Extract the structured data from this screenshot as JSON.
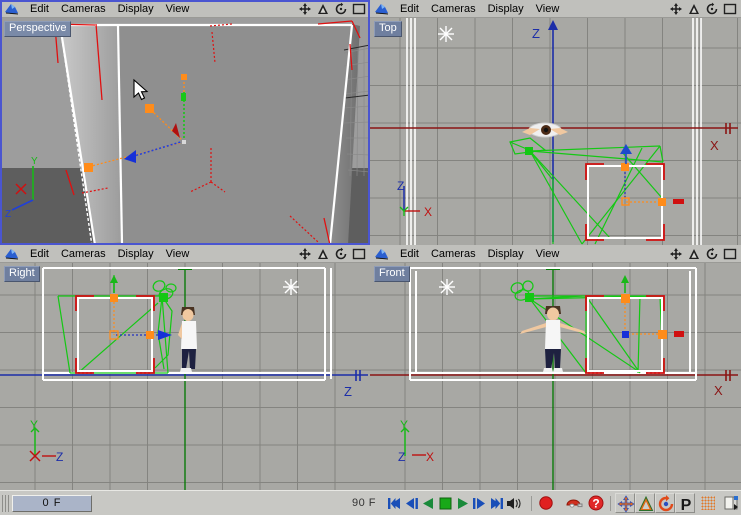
{
  "app": {
    "name": "Cinema 4D",
    "logo_icon": "c4d-logo-icon"
  },
  "viewport_menu": {
    "items": [
      "Edit",
      "Cameras",
      "Display",
      "View"
    ],
    "icons": [
      {
        "name": "move-view-icon",
        "glyph": "✥"
      },
      {
        "name": "scale-view-icon",
        "glyph": "▲"
      },
      {
        "name": "rotate-view-icon",
        "glyph": "↻"
      },
      {
        "name": "maximize-view-icon",
        "glyph": "▭"
      }
    ]
  },
  "viewports": [
    {
      "id": "perspective",
      "label": "Perspective",
      "active": true,
      "axis_gizmo": {
        "x": "X",
        "y": "Y",
        "z": "Z"
      },
      "shaded": true
    },
    {
      "id": "top",
      "label": "Top",
      "active": false,
      "axis_gizmo": {
        "x": "X",
        "z": "Z"
      },
      "world_axis_labels": {
        "vertical": "Z",
        "horizontal": "X"
      },
      "shaded": false
    },
    {
      "id": "right",
      "label": "Right",
      "active": false,
      "axis_gizmo": {
        "x": "X",
        "y": "Y",
        "z": "Z"
      },
      "world_axis_labels": {
        "vertical": "Y",
        "horizontal": "Z"
      },
      "shaded": false
    },
    {
      "id": "front",
      "label": "Front",
      "active": false,
      "axis_gizmo": {
        "x": "X",
        "y": "Y",
        "z": "Z"
      },
      "world_axis_labels": {
        "vertical": "Y",
        "horizontal": "X"
      },
      "shaded": false
    }
  ],
  "statusbar": {
    "current_frame": "0 F",
    "end_frame": "90 F",
    "transport": [
      {
        "name": "go-to-start-button",
        "title": "Go To Start"
      },
      {
        "name": "step-back-button",
        "title": "Previous Frame"
      },
      {
        "name": "play-reverse-button",
        "title": "Play Reverse"
      },
      {
        "name": "stop-button",
        "title": "Stop"
      },
      {
        "name": "play-forward-button",
        "title": "Play Forward"
      },
      {
        "name": "step-forward-button",
        "title": "Next Frame"
      },
      {
        "name": "go-to-end-button",
        "title": "Go To End"
      },
      {
        "name": "sound-toggle-button",
        "title": "Sound"
      }
    ],
    "record_tools": [
      {
        "name": "record-keyframe-button",
        "title": "Record Active Objects"
      },
      {
        "name": "autokeying-button",
        "title": "Autokeying"
      },
      {
        "name": "keyframe-selection-button",
        "title": "Keyframe Selection"
      }
    ],
    "key_filters": [
      {
        "name": "position-key-button",
        "glyph": "✥",
        "title": "Position"
      },
      {
        "name": "scale-key-button",
        "glyph": "▲",
        "title": "Scale"
      },
      {
        "name": "rotation-key-button",
        "glyph": "↻",
        "title": "Rotation"
      },
      {
        "name": "parameter-key-button",
        "glyph": "P",
        "title": "Parameter"
      },
      {
        "name": "point-level-animation-button",
        "title": "PLA"
      },
      {
        "name": "animation-layer-button",
        "title": "Animation Layer"
      }
    ]
  },
  "colors": {
    "axis_x": "#aa1111",
    "axis_y": "#11aa11",
    "axis_z": "#2222bb",
    "selection": "#4a55d0",
    "handle": "#ff8c1a",
    "spline": "#14c814",
    "chrome": "#c8c8c4",
    "viewport_bg": "#a8a8a4"
  }
}
